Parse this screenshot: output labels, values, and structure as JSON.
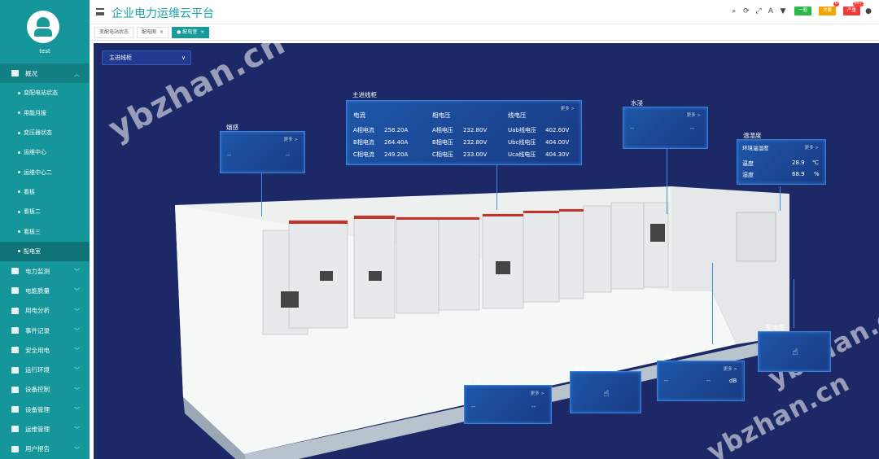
{
  "user": {
    "name": "test"
  },
  "app": {
    "title": "企业电力运维云平台"
  },
  "nav": [
    {
      "label": "概况",
      "expanded": true,
      "subs": [
        "变配电站状态",
        "用能月报",
        "变压器状态",
        "运维中心",
        "运维中心二",
        "看板",
        "看板二",
        "看板三",
        "配电室"
      ]
    },
    {
      "label": "电力监测"
    },
    {
      "label": "电能质量"
    },
    {
      "label": "用电分析"
    },
    {
      "label": "事件记录"
    },
    {
      "label": "安全用电"
    },
    {
      "label": "运行环境"
    },
    {
      "label": "设备控制"
    },
    {
      "label": "设备管理"
    },
    {
      "label": "运维管理"
    },
    {
      "label": "用户报告"
    }
  ],
  "badges": {
    "normal": {
      "label": "一般"
    },
    "secondary": {
      "label": "次要",
      "count": "0"
    },
    "severe": {
      "label": "严重",
      "count": "99+"
    }
  },
  "tabs": [
    {
      "label": "变配电站状态"
    },
    {
      "label": "配电图"
    },
    {
      "label": "配电室",
      "active": true
    }
  ],
  "selector": {
    "value": "主进线柜"
  },
  "panels": {
    "main": {
      "title": "主进线柜",
      "more": "更多 >",
      "current": {
        "header": "电流",
        "rows": [
          [
            "A相电流",
            "258.20A"
          ],
          [
            "B相电流",
            "264.40A"
          ],
          [
            "C相电流",
            "249.20A"
          ]
        ]
      },
      "phase_voltage": {
        "header": "相电压",
        "rows": [
          [
            "A相电压",
            "232.80V"
          ],
          [
            "B相电压",
            "232.80V"
          ],
          [
            "C相电压",
            "233.00V"
          ]
        ]
      },
      "line_voltage": {
        "header": "线电压",
        "rows": [
          [
            "Uab线电压",
            "402.60V"
          ],
          [
            "Ubc线电压",
            "404.00V"
          ],
          [
            "Uca线电压",
            "404.30V"
          ]
        ]
      }
    },
    "smoke": {
      "title": "烟感",
      "more": "更多 >",
      "v1": "--",
      "v2": "--"
    },
    "water": {
      "title": "水浸",
      "more": "更多 >",
      "v1": "--",
      "v2": "--"
    },
    "env": {
      "title": "温湿度",
      "subtitle": "环境温湿度",
      "more": "更多 >",
      "temp_label": "温度",
      "temp": "28.9",
      "temp_unit": "℃",
      "hum_label": "湿度",
      "hum": "68.9",
      "hum_unit": "%"
    },
    "door": {
      "title": "门禁",
      "more": "更多 >",
      "v1": "--",
      "v2": "--"
    },
    "camera": {
      "title": "摄像头"
    },
    "noise": {
      "title": "噪声",
      "more": "更多 >",
      "v1": "--",
      "v2": "--",
      "unit": "dB"
    },
    "diagram": {
      "title": "配电图"
    }
  },
  "watermarks": [
    "ybzhan.cn",
    "ybzhan.cn",
    "ybzhan.cn"
  ]
}
